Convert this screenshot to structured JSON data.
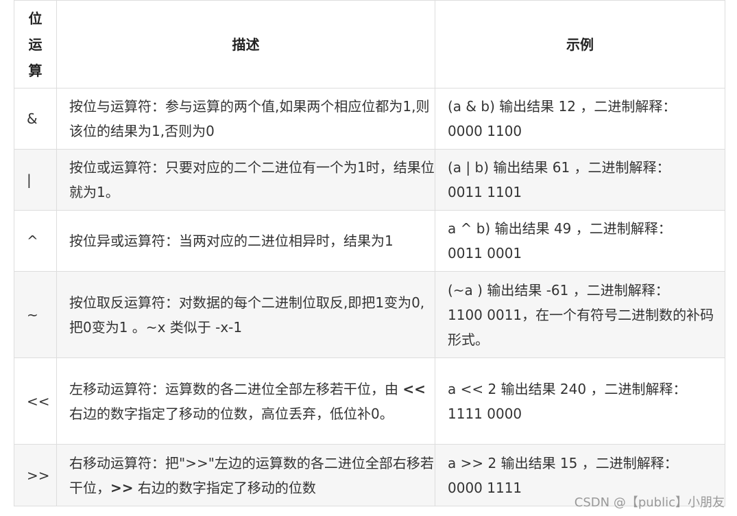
{
  "header": {
    "op_col": "位运算",
    "desc_col": "描述",
    "example_col": "示例"
  },
  "rows": [
    {
      "op": "&",
      "desc": "按位与运算符：参与运算的两个值,如果两个相应位都为1,则该位的结果为1,否则为0",
      "example_line1": "(a & b) 输出结果 12 ，二进制解释：",
      "example_line2": "0000 1100"
    },
    {
      "op": "|",
      "desc": "按位或运算符：只要对应的二个二进位有一个为1时，结果位就为1。",
      "example_line1": "(a | b) 输出结果 61 ，二进制解释：",
      "example_line2": "0011 1101"
    },
    {
      "op": "^",
      "desc": "按位异或运算符：当两对应的二进位相异时，结果为1",
      "example_line1": "a ^ b) 输出结果 49 ，二进制解释：",
      "example_line2": "0011 0001"
    },
    {
      "op": "~",
      "desc": "按位取反运算符：对数据的每个二进制位取反,即把1变为0,把0变为1 。~x 类似于 -x-1",
      "example_line1": "(~a ) 输出结果 -61 ，二进制解释：",
      "example_line2": "1100 0011，在一个有符号二进制数的补码形式。"
    },
    {
      "op": "<<",
      "desc_pre": "左移动运算符：运算数的各二进位全部左移若干位，由 ",
      "desc_sym": "<<",
      "desc_post": " 右边的数字指定了移动的位数，高位丢弃，低位补0。",
      "example_line1": "a << 2 输出结果 240 ，二进制解释：",
      "example_line2": "1111 0000"
    },
    {
      "op": ">>",
      "desc_pre": "右移动运算符：把\">>\"左边的运算数的各二进位全部右移若干位，",
      "desc_sym": ">>",
      "desc_post": " 右边的数字指定了移动的位数",
      "example_line1": "a >> 2 输出结果 15 ，二进制解释：",
      "example_line2": "0000 1111"
    }
  ],
  "watermark": "CSDN @【public】小朋友"
}
